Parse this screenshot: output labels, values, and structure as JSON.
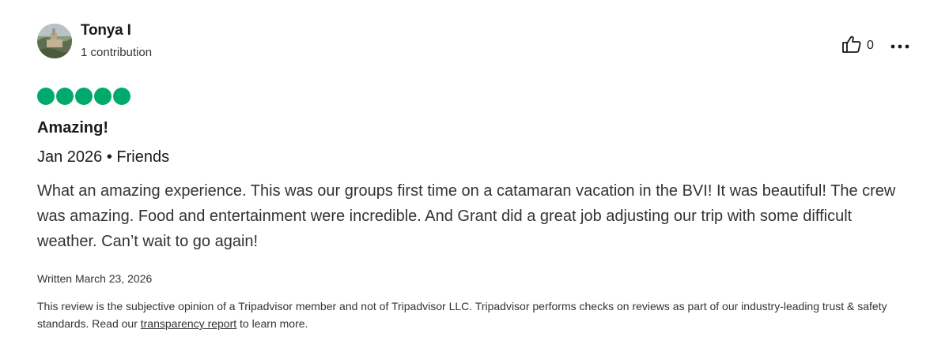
{
  "review": {
    "user": {
      "name": "Tonya I",
      "contributions": "1 contribution"
    },
    "helpful_count": "0",
    "rating": 5,
    "rating_color": "#00aa6c",
    "title": "Amazing!",
    "meta": "Jan 2026 • Friends",
    "body": "What an amazing experience. This was our groups first time on a catamaran vacation in the BVI! It was beautiful! The crew was amazing. Food and entertainment were incredible. And Grant did a great job adjusting our trip with some difficult weather. Can’t wait to go again!",
    "written": "Written March 23, 2026",
    "disclaimer_before": "This review is the subjective opinion of a Tripadvisor member and not of Tripadvisor LLC. Tripadvisor performs checks on reviews as part of our industry-leading trust & safety standards. Read our ",
    "disclaimer_link": "transparency report",
    "disclaimer_after": " to learn more."
  },
  "icons": {
    "helpful": "thumbs-up-icon",
    "more": "more-options-icon"
  }
}
